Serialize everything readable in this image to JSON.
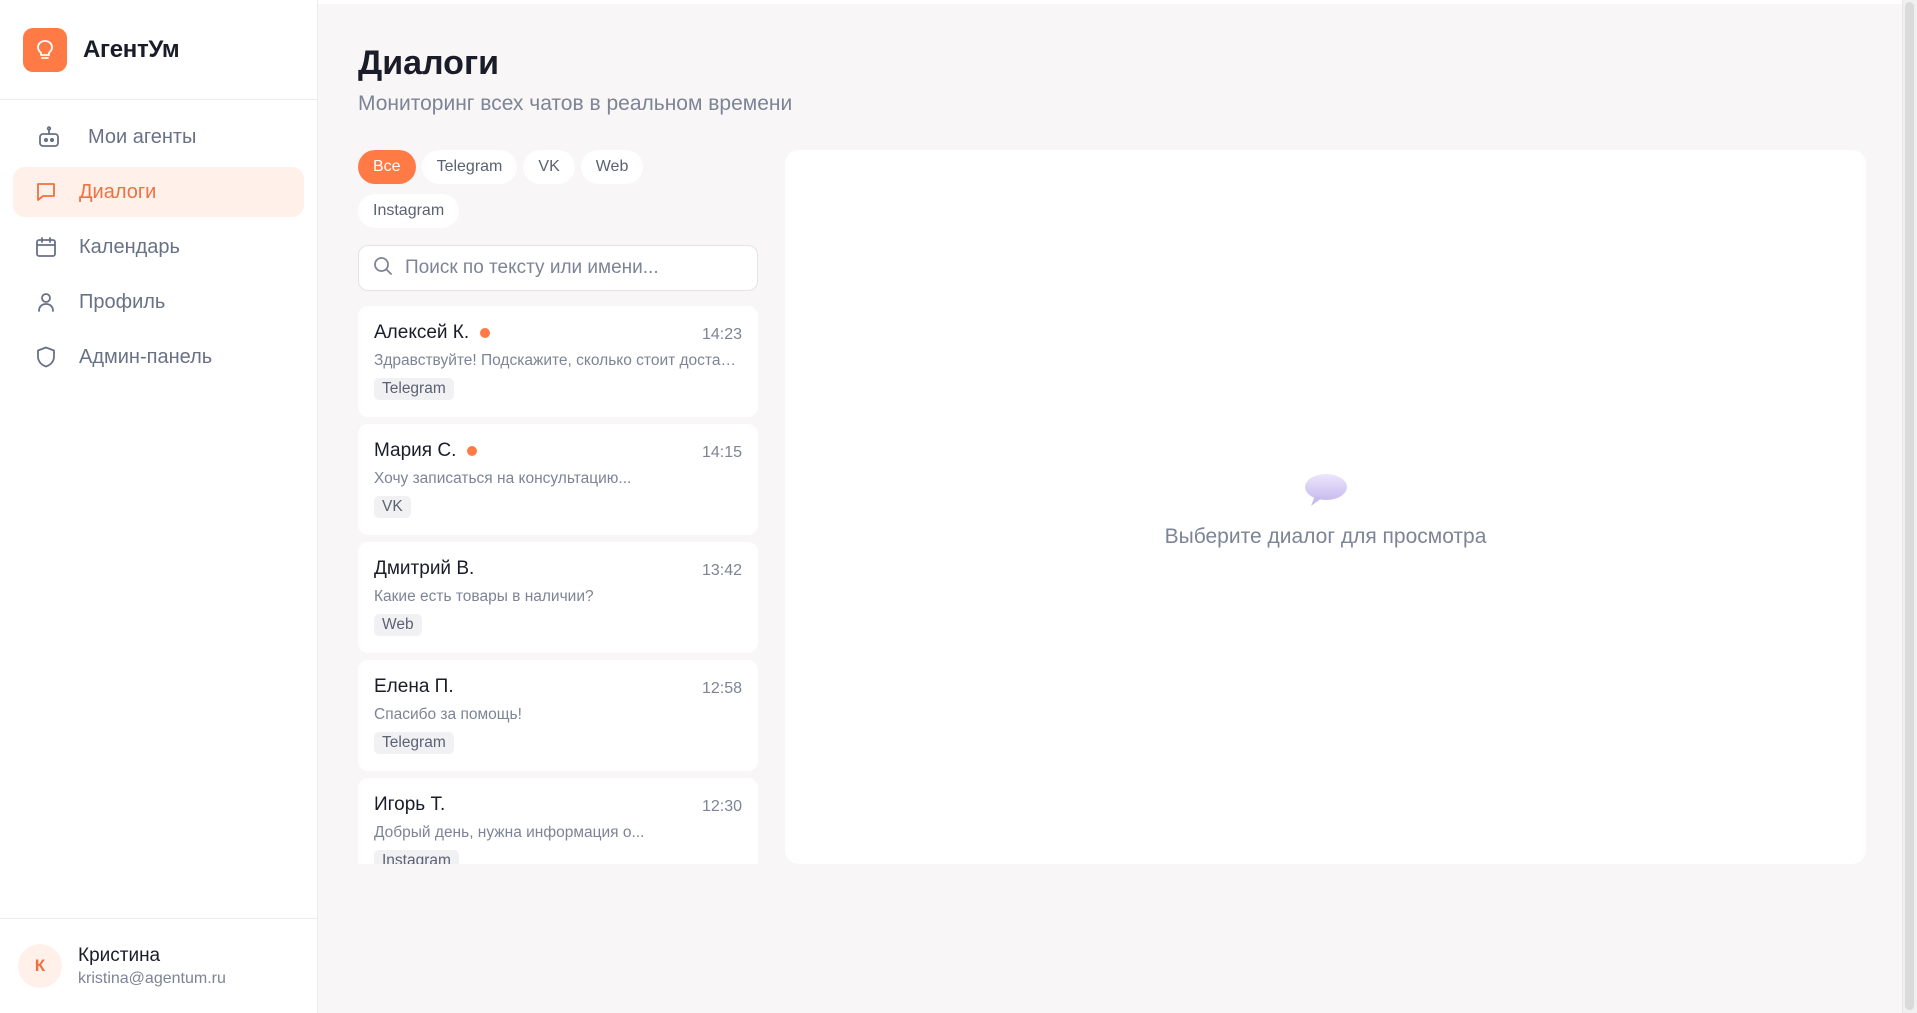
{
  "brand": {
    "name": "АгентУм"
  },
  "sidebar": {
    "items": [
      {
        "label": "Мои агенты",
        "icon": "robot-icon"
      },
      {
        "label": "Диалоги",
        "icon": "chat-icon",
        "active": true
      },
      {
        "label": "Календарь",
        "icon": "calendar-icon"
      },
      {
        "label": "Профиль",
        "icon": "user-icon"
      },
      {
        "label": "Админ-панель",
        "icon": "shield-icon"
      }
    ]
  },
  "user": {
    "initial": "К",
    "name": "Кристина",
    "email": "kristina@agentum.ru"
  },
  "page": {
    "title": "Диалоги",
    "subtitle": "Мониторинг всех чатов в реальном времени"
  },
  "filters": [
    "Все",
    "Telegram",
    "VK",
    "Web",
    "Instagram"
  ],
  "search": {
    "placeholder": "Поиск по тексту или имени..."
  },
  "dialogs": [
    {
      "name": "Алексей К.",
      "time": "14:23",
      "text": "Здравствуйте! Подскажите, сколько стоит доставка?",
      "tag": "Telegram",
      "unread": true
    },
    {
      "name": "Мария С.",
      "time": "14:15",
      "text": "Хочу записаться на консультацию...",
      "tag": "VK",
      "unread": true
    },
    {
      "name": "Дмитрий В.",
      "time": "13:42",
      "text": "Какие есть товары в наличии?",
      "tag": "Web",
      "unread": false
    },
    {
      "name": "Елена П.",
      "time": "12:58",
      "text": "Спасибо за помощь!",
      "tag": "Telegram",
      "unread": false
    },
    {
      "name": "Игорь Т.",
      "time": "12:30",
      "text": "Добрый день, нужна информация о...",
      "tag": "Instagram",
      "unread": false
    }
  ],
  "viewer": {
    "empty_text": "Выберите диалог для просмотра"
  },
  "colors": {
    "accent": "#ff7a45",
    "accent_soft": "#fff0ea",
    "muted": "#7c8496"
  }
}
